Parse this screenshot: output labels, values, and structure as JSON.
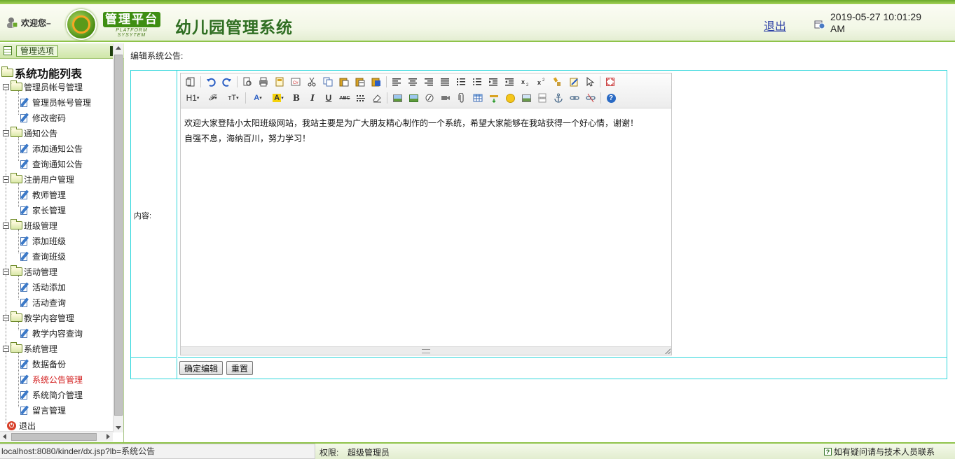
{
  "header": {
    "welcome": "欢迎您–",
    "platform_cn": "管理平台",
    "platform_en": "PLATFORM SYSYTEM",
    "system_title": "幼儿园管理系统",
    "logout": "退出",
    "datetime": "2019-05-27 10:01:29 AM"
  },
  "sidebar": {
    "tab_label": "管理选项",
    "root": "系统功能列表",
    "groups": [
      {
        "label": "管理员帐号管理",
        "items": [
          "管理员帐号管理",
          "修改密码"
        ]
      },
      {
        "label": "通知公告",
        "items": [
          "添加通知公告",
          "查询通知公告"
        ]
      },
      {
        "label": "注册用户管理",
        "items": [
          "教师管理",
          "家长管理"
        ]
      },
      {
        "label": "班级管理",
        "items": [
          "添加班级",
          "查询班级"
        ]
      },
      {
        "label": "活动管理",
        "items": [
          "活动添加",
          "活动查询"
        ]
      },
      {
        "label": "教学内容管理",
        "items": [
          "教学内容查询"
        ]
      },
      {
        "label": "系统管理",
        "items": [
          "数据备份",
          "系统公告管理",
          "系统简介管理",
          "留言管理"
        ]
      }
    ],
    "active_item": "系统公告管理",
    "logout": "退出"
  },
  "main": {
    "section_title": "编辑系统公告:",
    "content_label": "内容:",
    "editor_lines": [
      "欢迎大家登陆小太阳班级网站，我站主要是为广大朋友精心制作的一个系统，希望大家能够在我站获得一个好心情，谢谢！",
      "自强不息，海纳百川，努力学习！"
    ],
    "toolbar": {
      "heading": "H1",
      "font_family": "𝓕",
      "font_size": "тT",
      "font_color": "A",
      "highlight": "A",
      "bold": "B",
      "italic": "I",
      "underline": "U",
      "strike": "ABC"
    },
    "confirm_button": "确定编辑",
    "reset_button": "重置"
  },
  "statusbar": {
    "url": "localhost:8080/kinder/dx.jsp?lb=系统公告",
    "permission_label": "权限:",
    "permission_value": "超级管理员",
    "contact": "如有疑问请与技术人员联系"
  },
  "colors": {
    "header_green": "#2f6e22",
    "accent_green": "#8fc34a",
    "active_item": "#d21c1c",
    "table_border": "#31d7dc",
    "link_blue": "#2b3fa5"
  }
}
